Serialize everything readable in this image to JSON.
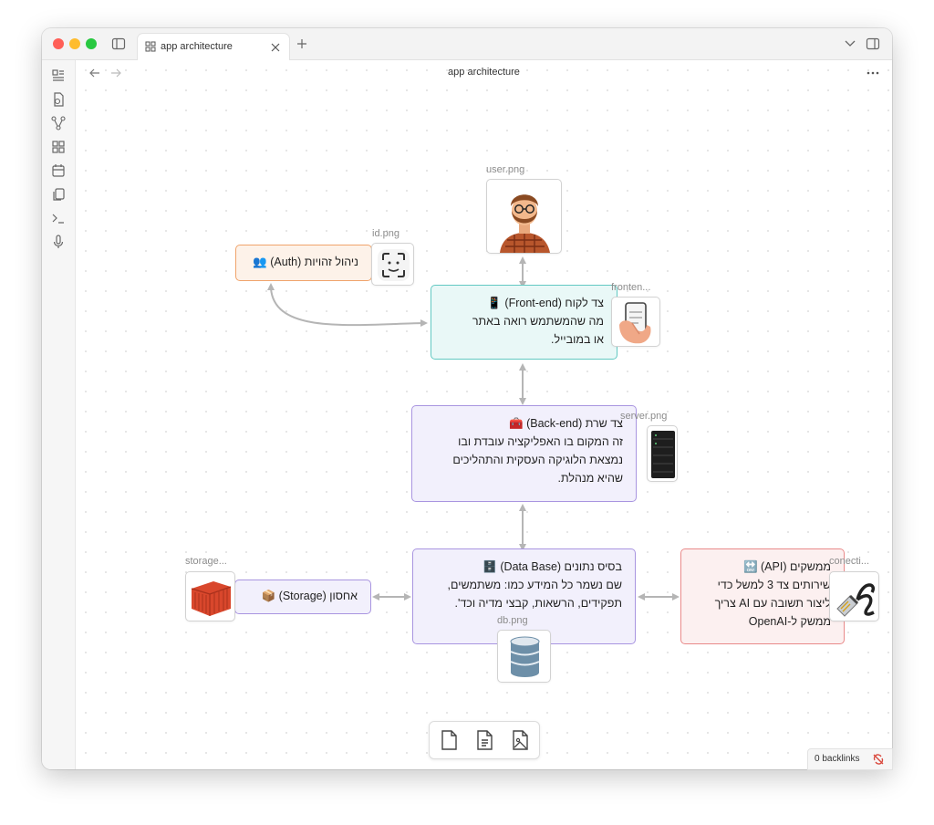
{
  "window": {
    "tab_title": "app architecture",
    "view_title": "app architecture",
    "traffic_lights": [
      "#ff5f57",
      "#febc2e",
      "#28c840"
    ]
  },
  "ribbon": {
    "icons": [
      "dashboard-icon",
      "file-plus-icon",
      "graph-icon",
      "grid-icon",
      "calendar-icon",
      "copy-icon",
      "terminal-icon",
      "microphone-icon"
    ]
  },
  "canvas": {
    "nodes": {
      "auth": {
        "label": "ניהול זהויות (Auth) 👥",
        "color": "#f0a36b"
      },
      "frontend": {
        "lines": [
          "צד לקוח (Front-end) 📱",
          "מה שהמשתמש רואה באתר",
          "או במובייל."
        ],
        "color": "#63c9c2"
      },
      "backend": {
        "lines": [
          "צד שרת (Back-end) 🧰",
          "זה המקום בו האפליקציה עובדת ובו",
          "נמצאת הלוגיקה העסקית והתהליכים",
          "שהיא מנהלת."
        ],
        "color": "#a995e0"
      },
      "database": {
        "lines": [
          "בסיס נתונים (Data Base) 🗄️",
          "שם נשמר כל המידע כמו: משתמשים,",
          "תפקידים, הרשאות, קבצי מדיה וכד'."
        ],
        "color": "#a995e0"
      },
      "storage": {
        "label": "אחסון (Storage) 📦",
        "color": "#a995e0"
      },
      "api": {
        "lines": [
          "ממשקים (API) 🔛",
          "שירותים צד 3 למשל כדי",
          "ליצור תשובה עם AI צריך",
          "ממשק ל-OpenAI"
        ],
        "color": "#e98a8a"
      }
    },
    "images": {
      "user": "user.png",
      "id": "id.png",
      "frontend": "fronten...",
      "server": "server.png",
      "storage": "storage...",
      "connection": "conecti...",
      "db": "db.png"
    }
  },
  "controls": [
    "settings-icon",
    "zoom-in-icon",
    "reset-zoom-icon",
    "fit-screen-icon",
    "zoom-out-icon",
    "undo-icon",
    "redo-icon",
    "help-icon"
  ],
  "bottom_toolbar": [
    "new-note-icon",
    "add-file-icon",
    "add-media-icon"
  ],
  "status": {
    "backlinks": "0 backlinks"
  }
}
